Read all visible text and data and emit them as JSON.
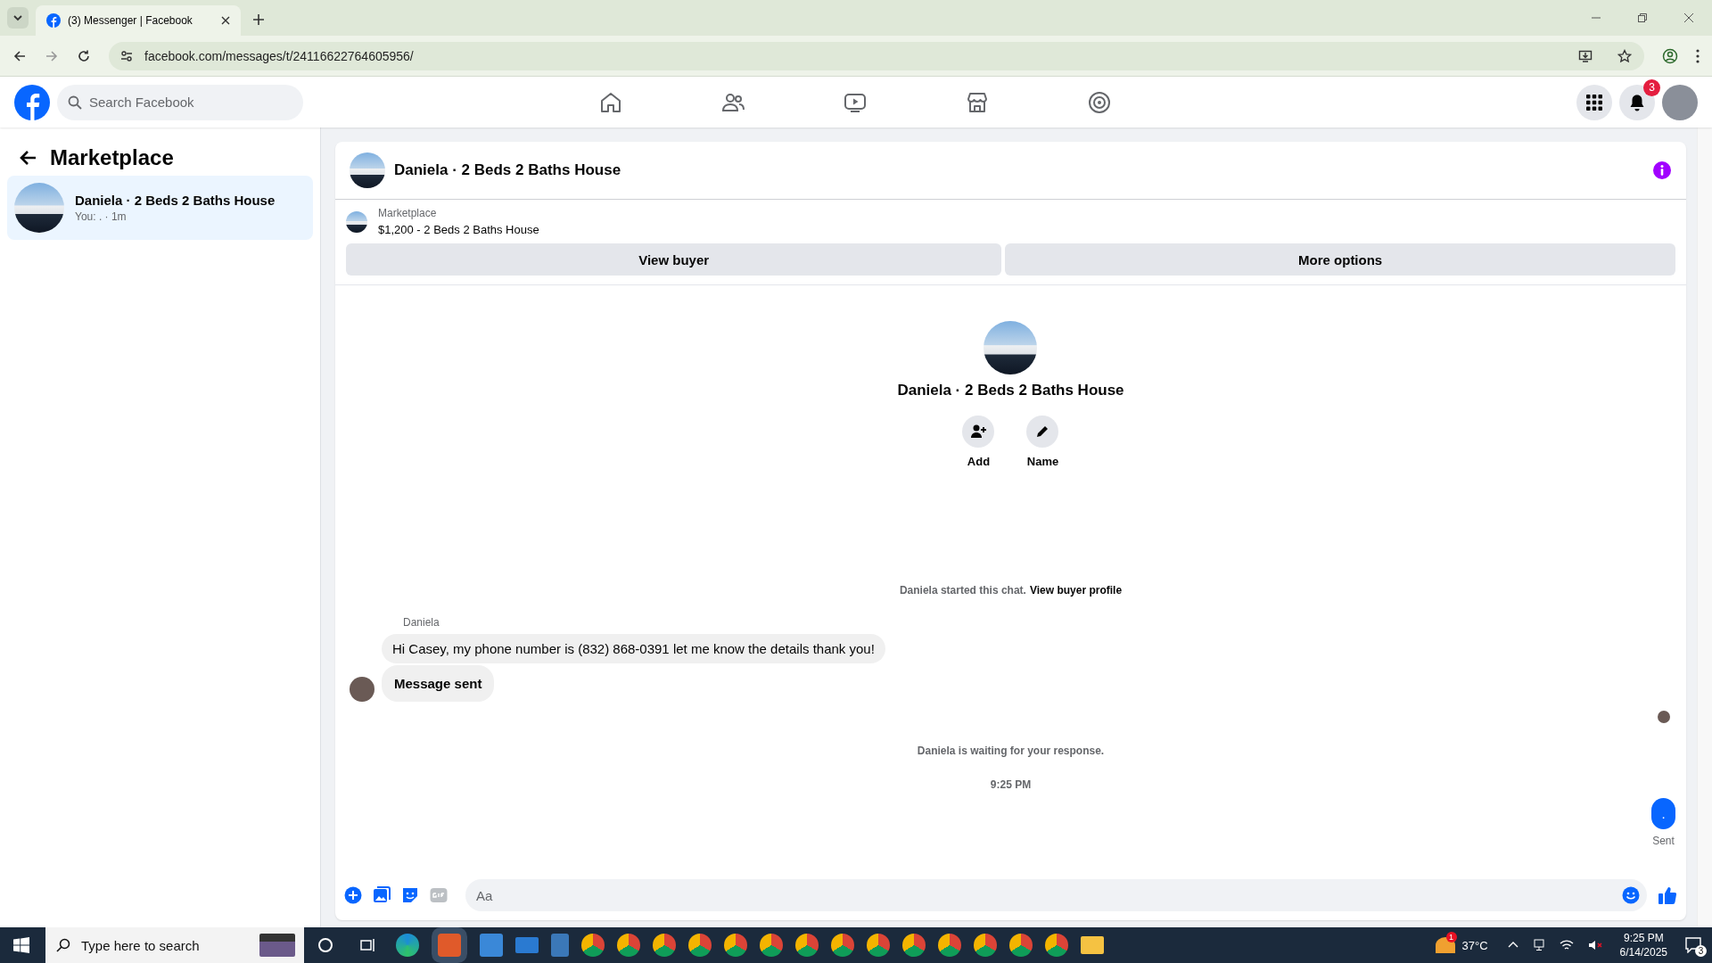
{
  "browser": {
    "tabs": [
      {
        "title": "(3) Messenger | Facebook",
        "selected": true
      }
    ],
    "url": "facebook.com/messages/t/24116622764605956/"
  },
  "topbar": {
    "search_placeholder": "Search Facebook",
    "notification_count": "3"
  },
  "sidebar": {
    "title": "Marketplace",
    "conversations": [
      {
        "title": "Daniela · 2 Beds 2 Baths House",
        "preview": "You: . · 1m",
        "selected": true
      }
    ]
  },
  "chat": {
    "title": "Daniela · 2 Beds 2 Baths House",
    "listing": {
      "label": "Marketplace",
      "summary": "$1,200 - 2 Beds 2 Baths House"
    },
    "buttons": [
      "View buyer",
      "More options"
    ],
    "profile": {
      "name": "Daniela · 2 Beds 2 Baths House",
      "actions": [
        {
          "kind": "add",
          "label": "Add"
        },
        {
          "kind": "name",
          "label": "Name"
        }
      ]
    },
    "notice": {
      "text": "Daniela started this chat.",
      "link": "View buyer profile"
    },
    "sender": "Daniela",
    "messages": [
      {
        "text": "Hi Casey, my phone number is (832) 868-0391 let me know the details thank you!",
        "bold": false
      },
      {
        "text": "Message sent",
        "bold": true
      }
    ],
    "waiting": "Daniela is waiting for your response.",
    "time": "9:25 PM",
    "sent_message": ".",
    "sent_status": "Sent",
    "composer_placeholder": "Aa"
  },
  "taskbar": {
    "search_placeholder": "Type here to search",
    "weather_badge": "1",
    "temperature": "37°C",
    "time": "9:25 PM",
    "date": "6/14/2025",
    "notification_count": "3"
  }
}
